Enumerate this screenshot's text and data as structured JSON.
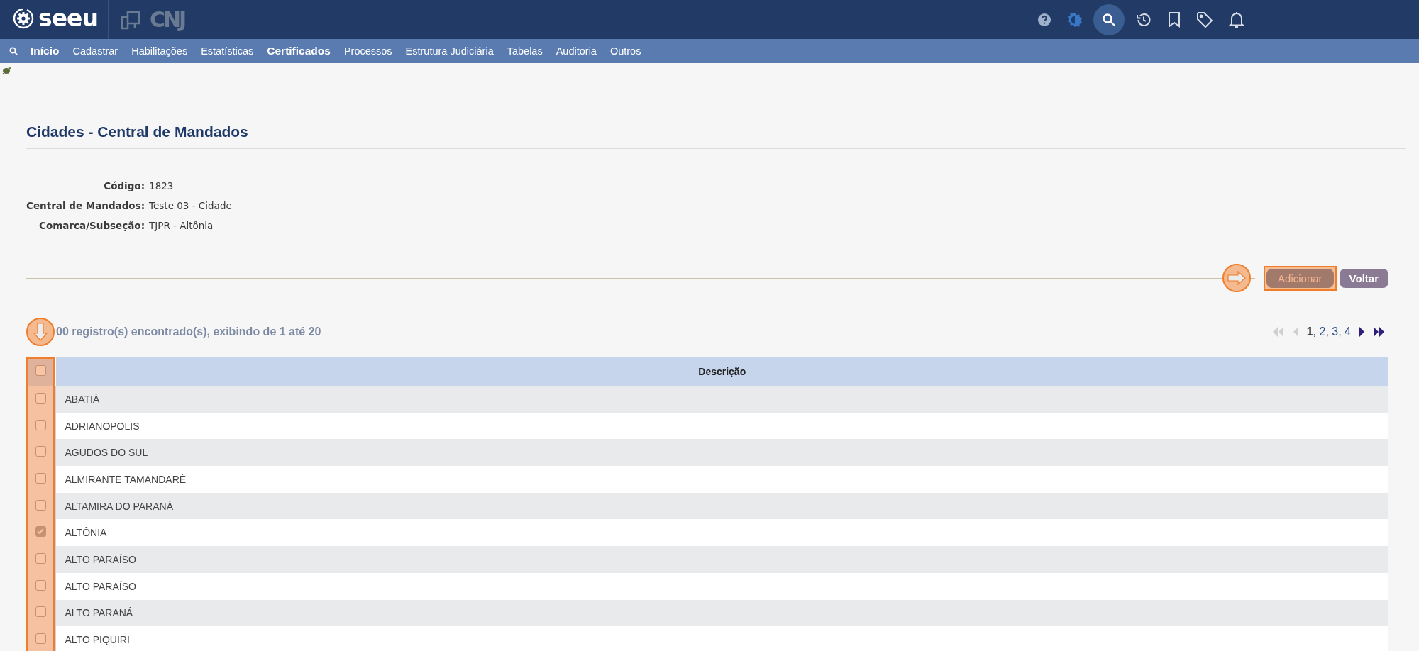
{
  "header": {
    "logo": "seeu",
    "partner_logo": "CNJ"
  },
  "nav": {
    "items": [
      {
        "label": "Início",
        "highlighted": true
      },
      {
        "label": "Cadastrar",
        "highlighted": false
      },
      {
        "label": "Habilitações",
        "highlighted": false
      },
      {
        "label": "Estatísticas",
        "highlighted": false
      },
      {
        "label": "Certificados",
        "highlighted": true
      },
      {
        "label": "Processos",
        "highlighted": false
      },
      {
        "label": "Estrutura Judiciária",
        "highlighted": false
      },
      {
        "label": "Tabelas",
        "highlighted": false
      },
      {
        "label": "Auditoria",
        "highlighted": false
      },
      {
        "label": "Outros",
        "highlighted": false
      }
    ]
  },
  "page": {
    "title": "Cidades - Central de Mandados",
    "fields": [
      {
        "label": "Código:",
        "value": "1823"
      },
      {
        "label": "Central de Mandados:",
        "value": "Teste 03 - Cidade"
      },
      {
        "label": "Comarca/Subseção:",
        "value": "TJPR - Altônia"
      }
    ]
  },
  "actions": [
    {
      "label": "Adicionar",
      "kind": "primary"
    },
    {
      "label": "Voltar",
      "kind": "secondary"
    }
  ],
  "results": {
    "summary": "00 registro(s) encontrado(s), exibindo de 1 até 20"
  },
  "pagination": {
    "separator": ",",
    "controls_before": [
      {
        "kind": "first",
        "disabled": true
      },
      {
        "kind": "previous",
        "disabled": true
      }
    ],
    "pages": [
      {
        "label": "1",
        "selected": true
      },
      {
        "label": "2",
        "selected": false
      },
      {
        "label": "3",
        "selected": false
      },
      {
        "label": "4",
        "selected": false
      }
    ],
    "controls_after": [
      {
        "kind": "next",
        "disabled": false
      },
      {
        "kind": "last",
        "disabled": false
      }
    ]
  },
  "table": {
    "columns": [
      "Descrição"
    ],
    "select_all": {
      "checked": false
    },
    "rows": [
      {
        "name": "ABATIÁ",
        "checked": false
      },
      {
        "name": "ADRIANÓPOLIS",
        "checked": false
      },
      {
        "name": "AGUDOS DO SUL",
        "checked": false
      },
      {
        "name": "ALMIRANTE TAMANDARÉ",
        "checked": false
      },
      {
        "name": "ALTAMIRA DO PARANÁ",
        "checked": false
      },
      {
        "name": "ALTÔNIA",
        "checked": true
      },
      {
        "name": "ALTO PARAÍSO",
        "checked": false
      },
      {
        "name": "ALTO PARAÍSO",
        "checked": false
      },
      {
        "name": "ALTO PARANÁ",
        "checked": false
      },
      {
        "name": "ALTO PIQUIRI",
        "checked": false
      }
    ]
  }
}
